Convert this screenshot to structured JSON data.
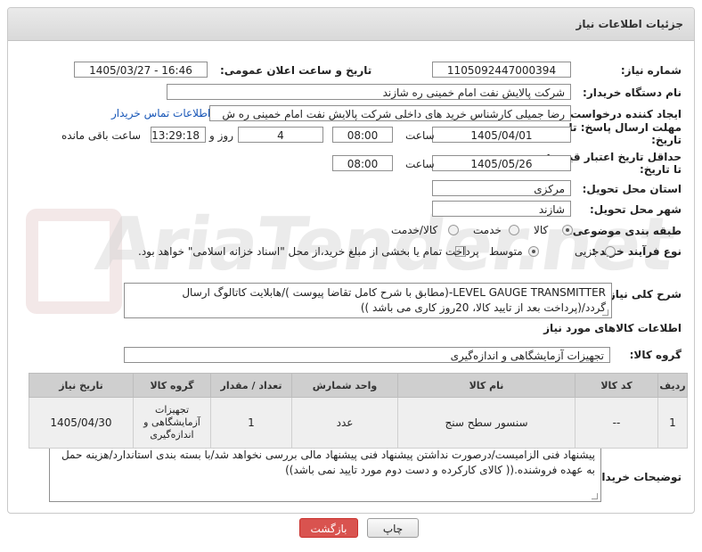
{
  "header": {
    "title": "جزئیات اطلاعات نیاز"
  },
  "form": {
    "need_number_label": "شماره نیاز:",
    "need_number": "1105092447000394",
    "announce_label": "تاریخ و ساعت اعلان عمومی:",
    "announce_value": "1405/03/27 - 16:46",
    "buyer_org_label": "نام دستگاه خریدار:",
    "buyer_org": "شرکت پالایش نفت امام خمینی  ره  شازند",
    "creator_label": "ایجاد کننده درخواست:",
    "creator": "رضا جمیلی کارشناس خرید های داخلی  شرکت پالایش نفت امام خمینی  ره  ش",
    "contact_link": "اطلاعات تماس خریدار",
    "deadline_label_1": "مهلت ارسال پاسخ: تا",
    "deadline_label_2": "تاریخ:",
    "deadline_date": "1405/04/01",
    "time_label": "ساعت",
    "deadline_time": "08:00",
    "days_value": "4",
    "days_label": "روز و",
    "remaining_time": "13:29:18",
    "remaining_label": "ساعت باقی مانده",
    "validity_label_1": "حداقل تاریخ اعتبار قیمت:",
    "validity_label_2": "تا تاریخ:",
    "validity_date": "1405/05/26",
    "validity_time": "08:00",
    "province_label": "استان محل تحویل:",
    "province": "مرکزی",
    "city_label": "شهر محل تحویل:",
    "city": "شازند",
    "category_label": "طبقه بندی موضوعی:",
    "category_options": [
      "کالا",
      "خدمت",
      "کالا/خدمت"
    ],
    "process_label": "نوع فرآیند خرید :",
    "process_options": [
      "جزیی",
      "متوسط"
    ],
    "payment_note": "پرداخت تمام یا بخشی از مبلغ خرید،از محل \"اسناد خزانه اسلامی\" خواهد بود.",
    "general_desc_label": "شرح کلی نیاز:",
    "general_desc": "LEVEL GAUGE TRANSMITTER-(مطابق با شرح کامل تقاضا پیوست )/هابلایت کاتالوگ  ارسال گردد/(پرداخت بعد از تایید کالا، 20روز کاری می باشد ))"
  },
  "goods": {
    "section_title": "اطلاعات کالاهای مورد نیاز",
    "group_label": "گروه کالا:",
    "group_value": "تجهیزات آزمایشگاهی و اندازه‌گیری",
    "columns": [
      "ردیف",
      "کد کالا",
      "نام کالا",
      "واحد شمارش",
      "تعداد / مقدار",
      "گروه کالا",
      "تاریخ نیاز"
    ],
    "rows": [
      {
        "row": "1",
        "code": "--",
        "name": "سنسور سطح سنج",
        "unit": "عدد",
        "qty": "1",
        "group": "تجهیزات آزمایشگاهی و اندازه‌گیری",
        "date": "1405/04/30"
      }
    ]
  },
  "buyer_notes": {
    "label": "توضیحات خریدار:",
    "text": "پیشنهاد فنی الزامیست/درصورت نداشتن پیشنهاد فنی پیشنهاد مالی بررسی نخواهد شد/با بسته بندی استاندارد/هزینه حمل به عهده فروشنده.(( کالای کارکرده و دست دوم مورد تایید نمی باشد))"
  },
  "buttons": {
    "print": "چاپ",
    "back": "بازگشت"
  },
  "watermark": "AriaTender.net",
  "colors": {
    "back_button": "#d9534f",
    "link": "#1a58b8",
    "table_header": "#cfcfcf"
  }
}
